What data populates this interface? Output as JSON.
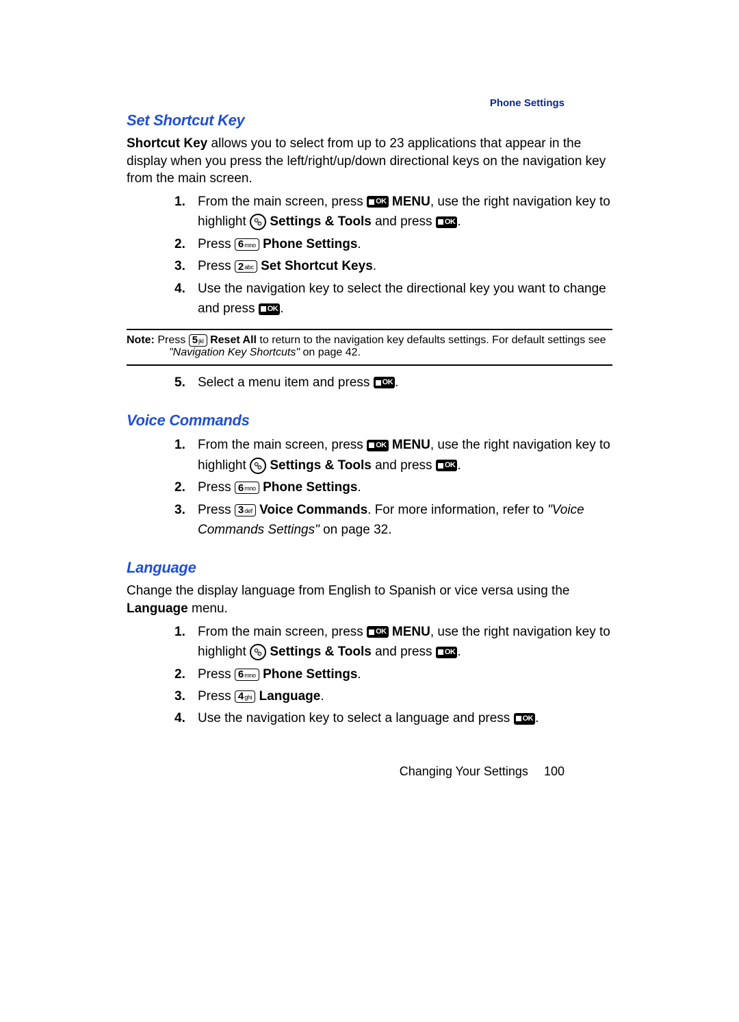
{
  "running_head": "Phone Settings",
  "sections": {
    "shortcut": {
      "title": "Set Shortcut Key",
      "intro_lead_bold": "Shortcut Key",
      "intro_rest": " allows you to select from up to 23 applications that appear in the display when you press the left/right/up/down directional keys on the navigation key from the main screen.",
      "s1_a": "From the main screen, press ",
      "s1_menu": " MENU",
      "s1_b": ", use the right navigation key to highlight ",
      "s1_tools": " Settings & Tools",
      "s1_c": " and press ",
      "s1_d": ".",
      "s2_a": "Press ",
      "s2_b": " Phone Settings",
      "s2_c": ".",
      "s3_a": "Press ",
      "s3_b": " Set Shortcut Keys",
      "s3_c": ".",
      "s4_a": "Use the navigation key to select the directional key you want to change and press ",
      "s4_b": ".",
      "note_label": "Note:",
      "note_a": " Press ",
      "note_b_bold": " Reset All",
      "note_c": " to return to the navigation key defaults settings. For default settings see ",
      "note_ref": "\"Navigation Key Shortcuts\"",
      "note_page": "  on page 42.",
      "s5_a": "Select a menu item and press ",
      "s5_b": "."
    },
    "voice": {
      "title": "Voice Commands",
      "s1_a": "From the main screen, press ",
      "s1_menu": " MENU",
      "s1_b": ", use the right navigation key to highlight ",
      "s1_tools": " Settings & Tools",
      "s1_c": " and press ",
      "s1_d": ".",
      "s2_a": "Press ",
      "s2_b": " Phone Settings",
      "s2_c": ".",
      "s3_a": "Press ",
      "s3_b": " Voice Commands",
      "s3_c": ". For more information, refer to ",
      "s3_ref": "\"Voice Commands Settings\"",
      "s3_page": "  on page 32."
    },
    "language": {
      "title": "Language",
      "intro_a": "Change the display language from English to Spanish or vice versa using the ",
      "intro_bold": "Language",
      "intro_b": " menu.",
      "s1_a": "From the main screen, press ",
      "s1_menu": " MENU",
      "s1_b": ", use the right navigation key to highlight ",
      "s1_tools": " Settings & Tools",
      "s1_c": " and press ",
      "s1_d": ".",
      "s2_a": "Press ",
      "s2_b": " Phone Settings",
      "s2_c": ".",
      "s3_a": "Press ",
      "s3_b": " Language",
      "s3_c": ".",
      "s4_a": "Use the navigation key to select a language and press ",
      "s4_b": "."
    }
  },
  "keys": {
    "k2_big": "2",
    "k2_sm": "abc",
    "k3_big": "3",
    "k3_sm": "def",
    "k4_big": "4",
    "k4_sm": "ghi",
    "k5_big": "5",
    "k5_sm": "jkl",
    "k6_big": "6",
    "k6_sm": "mno",
    "ok": "OK"
  },
  "nums": {
    "n1": "1.",
    "n2": "2.",
    "n3": "3.",
    "n4": "4.",
    "n5": "5."
  },
  "footer": {
    "text": "Changing Your Settings",
    "page": "100"
  }
}
